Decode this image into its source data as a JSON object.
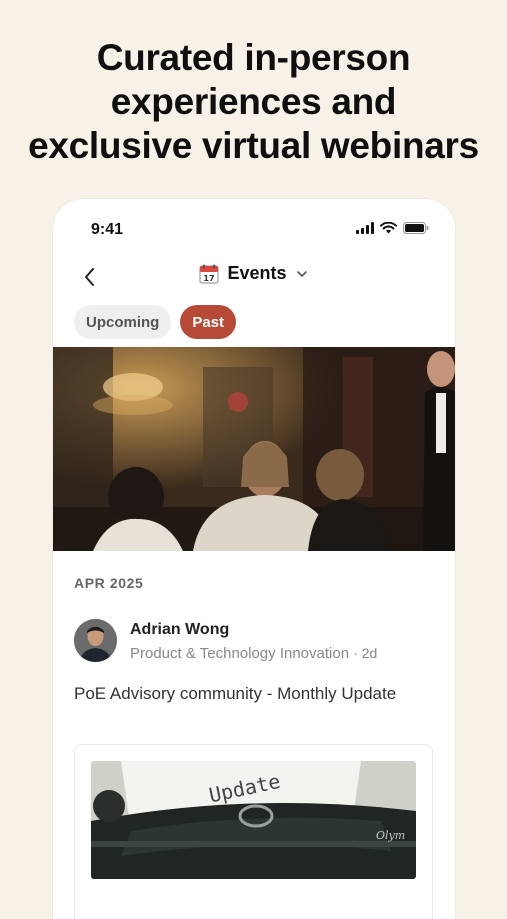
{
  "headline": {
    "line1": "Curated in-person",
    "line2": "experiences and",
    "line3": "exclusive virtual webinars"
  },
  "status_bar": {
    "time": "9:41",
    "icons": [
      "signal-icon",
      "wifi-icon",
      "battery-icon"
    ]
  },
  "nav": {
    "back_icon": "chevron-left-icon",
    "calendar_icon": "calendar-icon",
    "calendar_day": "17",
    "title": "Events",
    "dropdown_icon": "chevron-down-icon"
  },
  "tabs": [
    {
      "label": "Upcoming",
      "active": false
    },
    {
      "label": "Past",
      "active": true
    }
  ],
  "feed": {
    "date_label": "APR 2025",
    "author": {
      "name": "Adrian Wong",
      "subtitle": "Product & Technology Innovation",
      "age": "· 2d"
    },
    "post_title": "PoE Advisory community - Monthly Update",
    "card_image_text": "Update"
  },
  "colors": {
    "background": "#f8f1e8",
    "accent": "#b64a37",
    "tab_inactive": "#efefef"
  }
}
